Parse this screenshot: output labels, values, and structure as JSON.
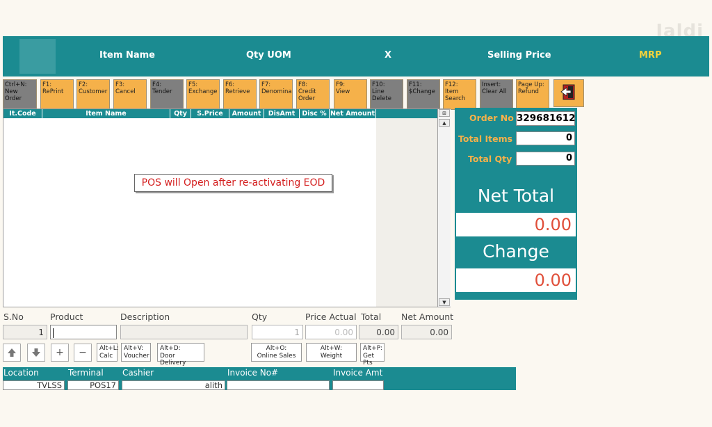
{
  "watermark": "Jaldi",
  "header": {
    "item_name": "Item Name",
    "qty_uom": "Qty UOM",
    "x": "X",
    "selling_price": "Selling Price",
    "mrp": "MRP"
  },
  "toolbar": [
    {
      "key": "Ctrl+N:",
      "label": "New Order",
      "style": "gray"
    },
    {
      "key": "F1:",
      "label": "RePrint",
      "style": "orange"
    },
    {
      "key": "F2:",
      "label": "Customer",
      "style": "orange"
    },
    {
      "key": "F3:",
      "label": "Cancel",
      "style": "orange"
    },
    {
      "key": "F4:",
      "label": "Tender",
      "style": "gray"
    },
    {
      "key": "F5:",
      "label": "Exchange",
      "style": "orange"
    },
    {
      "key": "F6:",
      "label": "Retrieve",
      "style": "orange"
    },
    {
      "key": "F7:",
      "label": "Denomina",
      "style": "orange"
    },
    {
      "key": "F8:",
      "label": "Credit Order",
      "style": "orange"
    },
    {
      "key": "F9:",
      "label": "View",
      "style": "orange"
    },
    {
      "key": "F10:",
      "label": "Line Delete",
      "style": "gray"
    },
    {
      "key": "F11:",
      "label": "$Change",
      "style": "gray"
    },
    {
      "key": "F12:",
      "label": "Item Search",
      "style": "orange"
    },
    {
      "key": "Insert:",
      "label": "Clear All",
      "style": "gray"
    },
    {
      "key": "Page Up:",
      "label": "Refund",
      "style": "orange"
    }
  ],
  "exit_icon": "exit-door-icon",
  "grid": {
    "columns": [
      "It.Code",
      "Item Name",
      "Qty",
      "S.Price",
      "Amount",
      "DisAmt",
      "Disc %",
      "Net Amount"
    ],
    "corner_icon": "column-chooser-icon",
    "scroll_up": "▲",
    "scroll_down": "▼"
  },
  "message": "POS will Open after re-activating EOD",
  "summary": {
    "order_no_label": "Order No",
    "order_no": "329681612",
    "total_items_label": "Total Items",
    "total_items": "0",
    "total_qty_label": "Total Qty",
    "total_qty": "0",
    "net_total_label": "Net Total",
    "net_total": "0.00",
    "change_label": "Change",
    "change": "0.00"
  },
  "entry": {
    "sno_label": "S.No",
    "sno": "1",
    "product_label": "Product",
    "product": "",
    "description_label": "Description",
    "description": "",
    "qty_label": "Qty",
    "qty": "1",
    "price_actual_label": "Price Actual",
    "price_actual": "0.00",
    "total_label": "Total",
    "total": "0.00",
    "net_amount_label": "Net Amount",
    "net_amount": "0.00"
  },
  "actions": {
    "up_icon": "up-arrow-icon",
    "down_icon": "down-arrow-icon",
    "plus": "+",
    "minus": "−",
    "calc": {
      "key": "Alt+L:",
      "label": "Calc"
    },
    "voucher": {
      "key": "Alt+V:",
      "label": "Voucher"
    },
    "door": {
      "key": "Alt+D:",
      "label": "Door Delivery"
    },
    "online": {
      "key": "Alt+O:",
      "label": "Online Sales"
    },
    "weight": {
      "key": "Alt+W:",
      "label": "Weight"
    },
    "points": {
      "key": "Alt+P:",
      "label": "Get Pts"
    }
  },
  "footer": {
    "location_label": "Location",
    "location": "TVLSS",
    "terminal_label": "Terminal",
    "terminal": "POS17",
    "cashier_label": "Cashier",
    "cashier": "alith",
    "invoice_no_label": "Invoice No#",
    "invoice_no": "",
    "invoice_amt_label": "Invoice Amt",
    "invoice_amt": ""
  },
  "colors": {
    "teal": "#1b8b91",
    "orange": "#f5b14a",
    "gray_button": "#7f7f7f",
    "money_red": "#e04f3a",
    "mrp_yellow": "#f5d33b"
  }
}
